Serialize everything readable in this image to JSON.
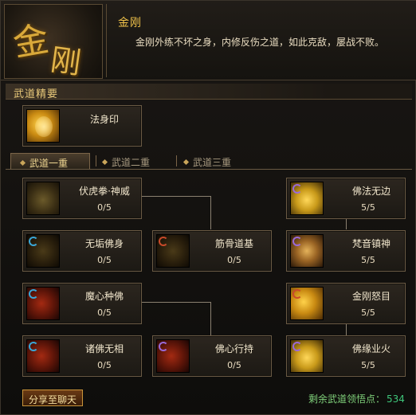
{
  "header": {
    "title": "金刚",
    "description": "金刚外练不坏之身，内修反伤之道，如此克敌，屡战不败。",
    "emblem_text": "金刚"
  },
  "section": {
    "title": "武道精要"
  },
  "featured_skill": {
    "name": "法身印"
  },
  "tabs": [
    {
      "label": "武道一重",
      "active": true
    },
    {
      "label": "武道二重",
      "active": false
    },
    {
      "label": "武道三重",
      "active": false
    }
  ],
  "skills": {
    "fuhu": {
      "name": "伏虎拳·神威",
      "level": "0/5"
    },
    "wugou": {
      "name": "无垢佛身",
      "level": "0/5"
    },
    "jingu": {
      "name": "筋骨道基",
      "level": "0/5"
    },
    "moxin": {
      "name": "魔心种佛",
      "level": "0/5"
    },
    "zhufo": {
      "name": "诸佛无相",
      "level": "0/5"
    },
    "foxin": {
      "name": "佛心行持",
      "level": "0/5"
    },
    "fofa": {
      "name": "佛法无边",
      "level": "5/5"
    },
    "fanyin": {
      "name": "梵音镇神",
      "level": "5/5"
    },
    "jingang": {
      "name": "金刚怒目",
      "level": "5/5"
    },
    "fuyuan": {
      "name": "佛缘业火",
      "level": "5/5"
    }
  },
  "footer": {
    "share_label": "分享至聊天",
    "points_label": "剩余武道领悟点：",
    "points_value": "534"
  },
  "colors": {
    "gold": "#f0c24a",
    "points_green": "#3ec67a"
  }
}
